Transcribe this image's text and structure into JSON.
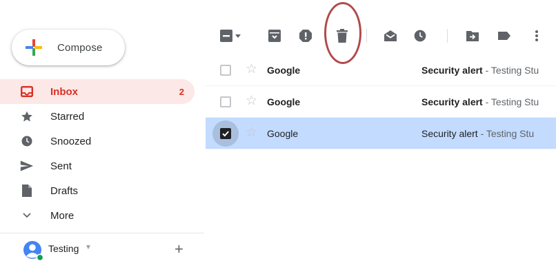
{
  "compose": {
    "label": "Compose"
  },
  "nav": [
    {
      "label": "Inbox",
      "icon": "inbox-icon",
      "count": "2",
      "active": true
    },
    {
      "label": "Starred",
      "icon": "star-icon"
    },
    {
      "label": "Snoozed",
      "icon": "clock-icon"
    },
    {
      "label": "Sent",
      "icon": "send-icon"
    },
    {
      "label": "Drafts",
      "icon": "draft-icon"
    },
    {
      "label": "More",
      "icon": "chevron-down-icon"
    }
  ],
  "account": {
    "name": "Testing",
    "add": "+"
  },
  "toolbar": {
    "icons": [
      "select-all-checkbox-icon",
      "select-dropdown-icon",
      "archive-icon",
      "report-spam-icon",
      "delete-icon",
      "mark-as-read-icon",
      "snooze-icon",
      "move-to-icon",
      "labels-icon",
      "more-options-icon"
    ]
  },
  "messages": [
    {
      "sender": "Google",
      "subject": "Security alert",
      "snippet": " - Testing Stu",
      "unread": true,
      "selected": false
    },
    {
      "sender": "Google",
      "subject": "Security alert",
      "snippet": " - Testing Stu",
      "unread": true,
      "selected": false
    },
    {
      "sender": "Google",
      "subject": "Security alert",
      "snippet": " - Testing Stu",
      "unread": false,
      "selected": true
    }
  ],
  "colors": {
    "accent_red": "#d93025",
    "active_bg": "#fce8e6",
    "selected_row": "#c2dbff",
    "annotation_ring": "#b04a4a"
  }
}
